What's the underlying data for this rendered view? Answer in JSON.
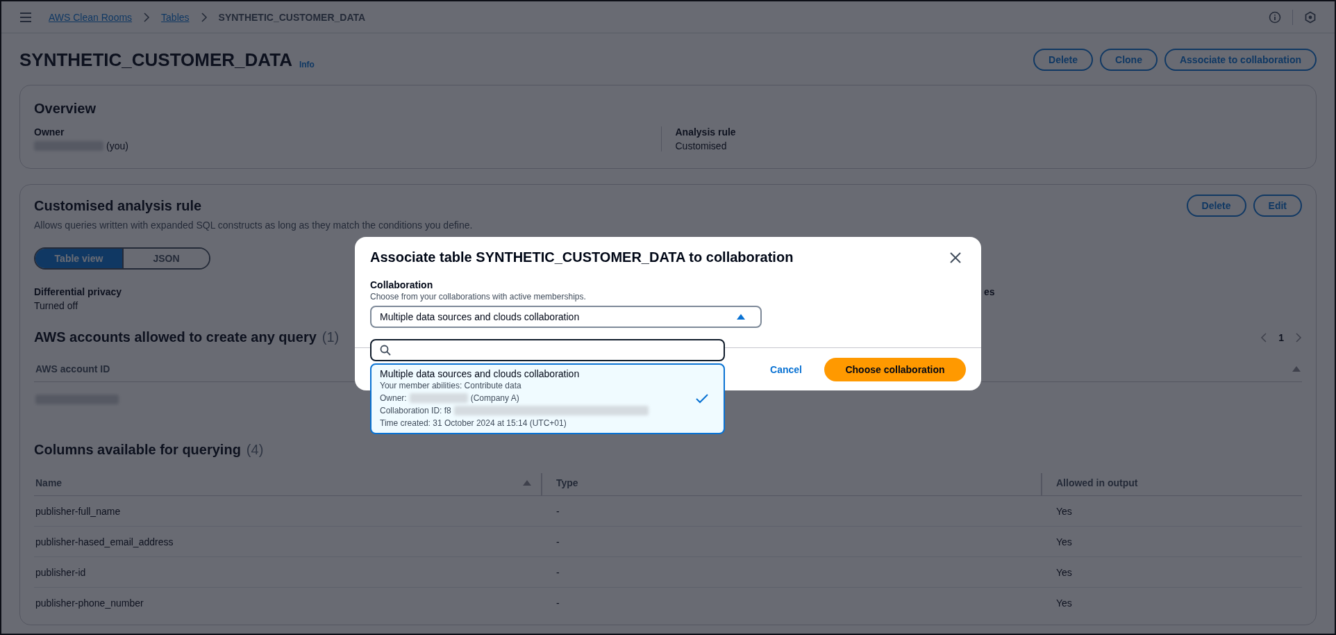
{
  "top_nav": {
    "breadcrumbs": [
      {
        "label": "AWS Clean Rooms",
        "link": true
      },
      {
        "label": "Tables",
        "link": true
      },
      {
        "label": "SYNTHETIC_CUSTOMER_DATA",
        "link": false
      }
    ]
  },
  "header": {
    "title": "SYNTHETIC_CUSTOMER_DATA",
    "info": "Info",
    "actions": [
      "Delete",
      "Clone",
      "Associate to collaboration"
    ]
  },
  "overview": {
    "title": "Overview",
    "fields": [
      {
        "label": "Owner",
        "value": "(you)",
        "redacted": true
      },
      {
        "label": "Analysis rule",
        "value": "Customised",
        "redacted": false
      }
    ]
  },
  "analysis_rule": {
    "title": "Customised analysis rule",
    "description": "Allows queries written with expanded SQL constructs as long as they match the conditions you define.",
    "actions": [
      "Delete",
      "Edit"
    ],
    "view_tabs": [
      {
        "label": "Table view",
        "selected": true
      },
      {
        "label": "JSON",
        "selected": false
      }
    ],
    "fields": [
      {
        "label": "Differential privacy",
        "value": "Turned off"
      },
      {
        "label": "es"
      }
    ],
    "accounts": {
      "title": "AWS accounts allowed to create any query",
      "count": "(1)",
      "page": "1",
      "columns": [
        "AWS account ID"
      ],
      "rows": [
        {
          "kind": "redacted"
        }
      ]
    },
    "columns_table": {
      "title": "Columns available for querying",
      "count": "(4)",
      "columns": [
        "Name",
        "Type",
        "Allowed in output"
      ],
      "rows": [
        [
          "publisher-full_name",
          "-",
          "Yes"
        ],
        [
          "publisher-hased_email_address",
          "-",
          "Yes"
        ],
        [
          "publisher-id",
          "-",
          "Yes"
        ],
        [
          "publisher-phone_number",
          "-",
          "Yes"
        ]
      ]
    }
  },
  "modal": {
    "title": "Associate table SYNTHETIC_CUSTOMER_DATA to collaboration",
    "field": {
      "label": "Collaboration",
      "description": "Choose from your collaborations with active memberships.",
      "value": "Multiple data sources and clouds collaboration",
      "expanded": true
    },
    "options": [
      {
        "title": "Multiple data sources and clouds collaboration",
        "selected": true,
        "lines": [
          {
            "kind": "text",
            "text": "Your member abilities: Contribute data"
          },
          {
            "kind": "redacted",
            "before": "Owner:",
            "after": "(Company A)"
          },
          {
            "kind": "redacted",
            "before": "Collaboration ID: f8"
          },
          {
            "kind": "text",
            "text": "Time created: 31 October 2024 at 15:14 (UTC+01)"
          }
        ]
      }
    ],
    "cancel": "Cancel",
    "submit": "Choose collaboration"
  }
}
